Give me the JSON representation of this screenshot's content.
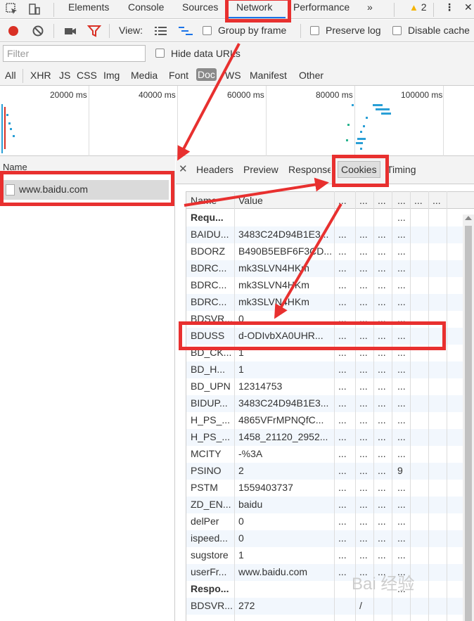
{
  "tabs": [
    "Elements",
    "Console",
    "Sources",
    "Network",
    "Performance"
  ],
  "more_tabs": "»",
  "warning_count": "2",
  "toolbar": {
    "view_label": "View:",
    "group_by_frame": "Group by frame",
    "preserve_log": "Preserve log",
    "disable_cache": "Disable cache"
  },
  "filter": {
    "placeholder": "Filter",
    "hide_data_urls": "Hide data URLs"
  },
  "type_filters": [
    "All",
    "XHR",
    "JS",
    "CSS",
    "Img",
    "Media",
    "Font",
    "Doc",
    "WS",
    "Manifest",
    "Other"
  ],
  "timeline": {
    "ticks": [
      "20000 ms",
      "40000 ms",
      "60000 ms",
      "80000 ms",
      "100000 ms"
    ]
  },
  "requests": {
    "header": "Name",
    "items": [
      "www.baidu.com"
    ]
  },
  "detail_tabs": [
    "Headers",
    "Preview",
    "Response",
    "Cookies",
    "Timing"
  ],
  "cookies": {
    "headers": [
      "Name",
      "Value",
      "...",
      "...",
      "...",
      "...",
      "...",
      "..."
    ],
    "rows": [
      {
        "name": "Requ...",
        "value": "",
        "c": [
          "",
          "",
          "",
          "..."
        ],
        "bold": true
      },
      {
        "name": "BAIDU...",
        "value": "3483C24D94B1E3...",
        "c": [
          "...",
          "...",
          "...",
          "..."
        ]
      },
      {
        "name": "BDORZ",
        "value": "B490B5EBF6F3CD...",
        "c": [
          "...",
          "...",
          "...",
          "..."
        ]
      },
      {
        "name": "BDRC...",
        "value": "mk3SLVN4HKm",
        "c": [
          "...",
          "...",
          "...",
          "..."
        ]
      },
      {
        "name": "BDRC...",
        "value": "mk3SLVN4HKm",
        "c": [
          "...",
          "...",
          "...",
          "..."
        ]
      },
      {
        "name": "BDRC...",
        "value": "mk3SLVN4HKm",
        "c": [
          "...",
          "...",
          "...",
          "..."
        ]
      },
      {
        "name": "BDSVR...",
        "value": "0",
        "c": [
          "...",
          "...",
          "...",
          "..."
        ]
      },
      {
        "name": "BDUSS",
        "value": "d-ODIvbXA0UHR...",
        "c": [
          "...",
          "...",
          "...",
          "..."
        ]
      },
      {
        "name": "BD_CK...",
        "value": "1",
        "c": [
          "...",
          "...",
          "...",
          "..."
        ]
      },
      {
        "name": "BD_H...",
        "value": "1",
        "c": [
          "...",
          "...",
          "...",
          "..."
        ]
      },
      {
        "name": "BD_UPN",
        "value": "12314753",
        "c": [
          "...",
          "...",
          "...",
          "..."
        ]
      },
      {
        "name": "BIDUP...",
        "value": "3483C24D94B1E3...",
        "c": [
          "...",
          "...",
          "...",
          "..."
        ]
      },
      {
        "name": "H_PS_...",
        "value": "4865VFrMPNQfC...",
        "c": [
          "...",
          "...",
          "...",
          "..."
        ]
      },
      {
        "name": "H_PS_...",
        "value": "1458_21120_2952...",
        "c": [
          "...",
          "...",
          "...",
          "..."
        ]
      },
      {
        "name": "MCITY",
        "value": "-%3A",
        "c": [
          "...",
          "...",
          "...",
          "..."
        ]
      },
      {
        "name": "PSINO",
        "value": "2",
        "c": [
          "...",
          "...",
          "...",
          "9"
        ]
      },
      {
        "name": "PSTM",
        "value": "1559403737",
        "c": [
          "...",
          "...",
          "...",
          "..."
        ]
      },
      {
        "name": "ZD_EN...",
        "value": "baidu",
        "c": [
          "...",
          "...",
          "...",
          "..."
        ]
      },
      {
        "name": "delPer",
        "value": "0",
        "c": [
          "...",
          "...",
          "...",
          "..."
        ]
      },
      {
        "name": "ispeed...",
        "value": "0",
        "c": [
          "...",
          "...",
          "...",
          "..."
        ]
      },
      {
        "name": "sugstore",
        "value": "1",
        "c": [
          "...",
          "...",
          "...",
          "..."
        ]
      },
      {
        "name": "userFr...",
        "value": "www.baidu.com",
        "c": [
          "...",
          "...",
          "...",
          "..."
        ]
      },
      {
        "name": "Respo...",
        "value": "",
        "c": [
          "",
          "",
          "",
          "..."
        ],
        "bold": true
      },
      {
        "name": "BDSVR...",
        "value": "272",
        "c": [
          "",
          "/",
          "",
          ""
        ]
      }
    ]
  },
  "watermark": "Bai 经验",
  "colors": {
    "accent": "#1a73e8",
    "record": "#d93025",
    "highlight": "#e8302f",
    "row_alt": "#f2f7fd"
  }
}
